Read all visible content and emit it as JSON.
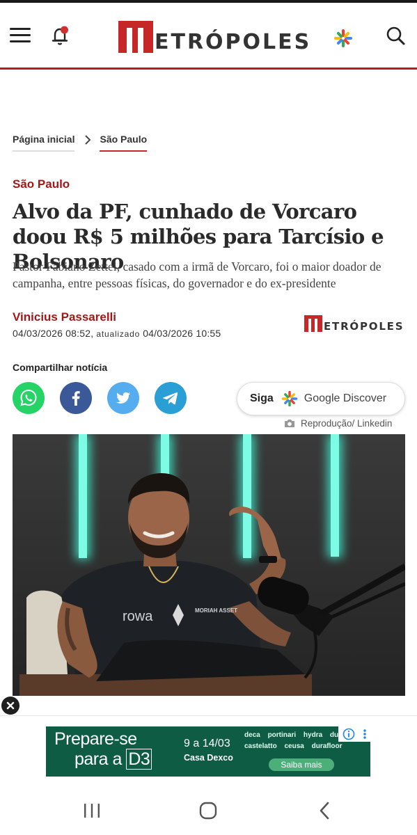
{
  "header": {
    "logo_text": "ETRÓPOLES",
    "icons": [
      "menu-icon",
      "bell-icon",
      "google-discover-icon",
      "search-icon"
    ]
  },
  "breadcrumb": {
    "home": "Página inicial",
    "current": "São Paulo"
  },
  "article": {
    "section": "São Paulo",
    "title": "Alvo da PF, cunhado de Vorcaro doou R$ 5 milhões para Tarcísio e Bolsonaro",
    "subtitle": "Pastor Fabiano Zettel, casado com a irmã de Vorcaro, foi o maior doador de campanha, entre pessoas físicas, do governador e do ex-presidente",
    "author": "Vinicius Passarelli",
    "published": "04/03/2026 08:52,",
    "updated_label": "atualizado",
    "updated": "04/03/2026 10:55",
    "source_logo_text": "ETRÓPOLES"
  },
  "share": {
    "label": "Compartilhar notícia",
    "networks": [
      "whatsapp-icon",
      "facebook-icon",
      "twitter-icon",
      "telegram-icon"
    ]
  },
  "follow": {
    "siga": "Siga",
    "google_discover": "Google Discover"
  },
  "photo": {
    "credit": "Reprodução/ Linkedin",
    "shirt_text": "rowa",
    "patch_text": "MORIAH ASSET"
  },
  "ad": {
    "line1": "Prepare-se",
    "line2": "para a",
    "d3": "D3",
    "dates": "9 a 14/03",
    "place": "Casa Dexco",
    "brands": "deca portinari hydra duratex castelatto ceusa durafloor",
    "cta": "Saiba mais"
  },
  "colors": {
    "brand_red": "#c62828",
    "section_red": "#a01818",
    "ad_green": "#0f5c45"
  }
}
